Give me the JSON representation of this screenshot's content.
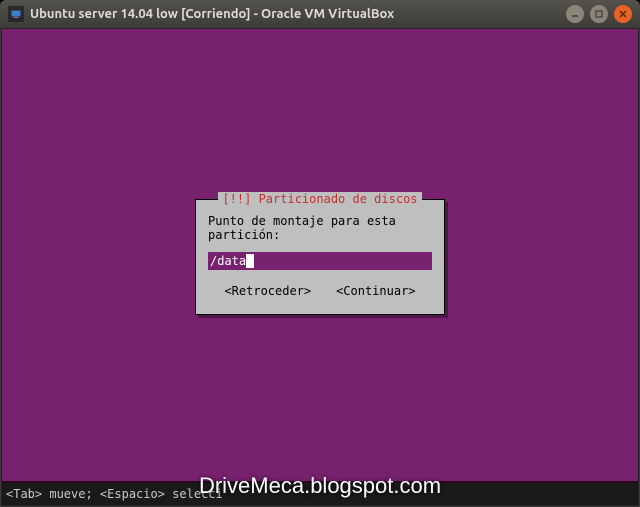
{
  "window": {
    "title": "Ubuntu server 14.04 low [Corriendo] - Oracle VM VirtualBox"
  },
  "dialog": {
    "title": "[!!] Particionado de discos",
    "prompt": "Punto de montaje para esta partición:",
    "input_value": "/data",
    "back_label": "<Retroceder>",
    "continue_label": "<Continuar>"
  },
  "helpbar": {
    "text": "<Tab> mueve; <Espacio> selecci"
  },
  "watermark": {
    "text": "DriveMeca.blogspot.com"
  }
}
